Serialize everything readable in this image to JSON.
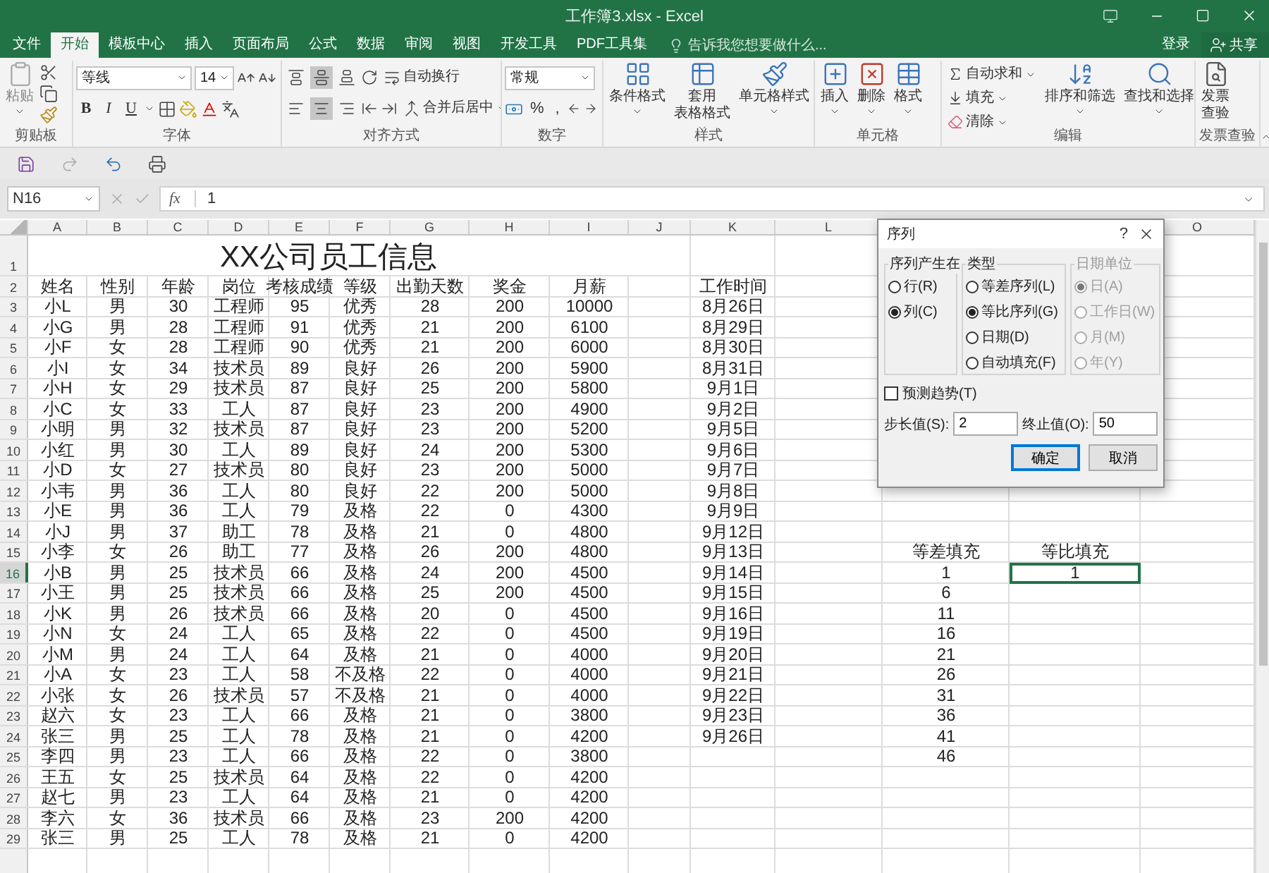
{
  "window": {
    "title": "工作簿3.xlsx - Excel"
  },
  "tabs": [
    {
      "label": "文件",
      "selected": false
    },
    {
      "label": "开始",
      "selected": true
    },
    {
      "label": "模板中心",
      "selected": false
    },
    {
      "label": "插入",
      "selected": false
    },
    {
      "label": "页面布局",
      "selected": false
    },
    {
      "label": "公式",
      "selected": false
    },
    {
      "label": "数据",
      "selected": false
    },
    {
      "label": "审阅",
      "selected": false
    },
    {
      "label": "视图",
      "selected": false
    },
    {
      "label": "开发工具",
      "selected": false
    },
    {
      "label": "PDF工具集",
      "selected": false
    }
  ],
  "tell_me": {
    "placeholder": "告诉我您想要做什么..."
  },
  "account": {
    "sign_in": "登录",
    "share": "共享"
  },
  "ribbon": {
    "groups": [
      {
        "kind": "clipboard",
        "label": "剪贴板",
        "buttons": [
          [
            "粘贴"
          ]
        ]
      },
      {
        "kind": "font",
        "label": "字体",
        "font": "等线",
        "size": "14",
        "format_buttons": [
          "B",
          "I",
          "U"
        ]
      },
      {
        "kind": "alignment",
        "label": "对齐方式",
        "buttons": [
          "自动换行",
          "合并后居中"
        ],
        "vertical": [
          {
            "selected": false
          },
          {
            "selected": true
          },
          {
            "selected": false
          }
        ],
        "horizontal": [
          {
            "selected": false
          },
          {
            "selected": true
          },
          {
            "selected": false
          }
        ]
      },
      {
        "kind": "number",
        "label": "数字",
        "format": "常规",
        "symbols": [
          "%",
          ","
        ]
      },
      {
        "kind": "styles",
        "label": "样式",
        "buttons": [
          [
            "条件格式"
          ],
          [
            "套用",
            "表格格式"
          ],
          [
            "单元格样式"
          ]
        ]
      },
      {
        "kind": "cells",
        "label": "单元格",
        "buttons": [
          [
            "插入"
          ],
          [
            "删除"
          ],
          [
            "格式"
          ]
        ]
      },
      {
        "kind": "editing",
        "label": "编辑",
        "small_buttons": [
          "自动求和",
          "填充",
          "清除"
        ],
        "buttons": [
          [
            "排序和筛选"
          ],
          [
            "查找和选择"
          ]
        ]
      },
      {
        "kind": "invoice",
        "label": "发票查验",
        "buttons": [
          [
            "发票",
            "查验"
          ]
        ]
      }
    ]
  },
  "formula_bar": {
    "name_box": "N16",
    "fx": "fx",
    "value": "1"
  },
  "sheet": {
    "column_headers": [
      "A",
      "B",
      "C",
      "D",
      "E",
      "F",
      "G",
      "H",
      "I",
      "J",
      "K",
      "L",
      "O"
    ],
    "rows": [
      {
        "number": "1",
        "selected": false,
        "title": "XX公司员工信息"
      },
      {
        "number": "2",
        "selected": false,
        "cells": [
          "姓名",
          "性别",
          "年龄",
          "岗位",
          "考核成绩",
          "等级",
          "出勤天数",
          "奖金",
          "月薪"
        ],
        "column_k": "工作时间"
      },
      {
        "number": "3",
        "selected": false,
        "cells": [
          "小L",
          "男",
          "30",
          "工程师",
          "95",
          "优秀",
          "28",
          "200",
          "10000"
        ],
        "column_k": "8月26日"
      },
      {
        "number": "4",
        "selected": false,
        "cells": [
          "小G",
          "男",
          "28",
          "工程师",
          "91",
          "优秀",
          "21",
          "200",
          "6100"
        ],
        "column_k": "8月29日"
      },
      {
        "number": "5",
        "selected": false,
        "cells": [
          "小F",
          "女",
          "28",
          "工程师",
          "90",
          "优秀",
          "21",
          "200",
          "6000"
        ],
        "column_k": "8月30日"
      },
      {
        "number": "6",
        "selected": false,
        "cells": [
          "小I",
          "女",
          "34",
          "技术员",
          "89",
          "良好",
          "26",
          "200",
          "5900"
        ],
        "column_k": "8月31日"
      },
      {
        "number": "7",
        "selected": false,
        "cells": [
          "小H",
          "女",
          "29",
          "技术员",
          "87",
          "良好",
          "25",
          "200",
          "5800"
        ],
        "column_k": "9月1日"
      },
      {
        "number": "8",
        "selected": false,
        "cells": [
          "小C",
          "女",
          "33",
          "工人",
          "87",
          "良好",
          "23",
          "200",
          "4900"
        ],
        "column_k": "9月2日"
      },
      {
        "number": "9",
        "selected": false,
        "cells": [
          "小明",
          "男",
          "32",
          "技术员",
          "87",
          "良好",
          "23",
          "200",
          "5200"
        ],
        "column_k": "9月5日"
      },
      {
        "number": "10",
        "selected": false,
        "cells": [
          "小红",
          "男",
          "30",
          "工人",
          "89",
          "良好",
          "24",
          "200",
          "5300"
        ],
        "column_k": "9月6日"
      },
      {
        "number": "11",
        "selected": false,
        "cells": [
          "小D",
          "女",
          "27",
          "技术员",
          "80",
          "良好",
          "23",
          "200",
          "5000"
        ],
        "column_k": "9月7日"
      },
      {
        "number": "12",
        "selected": false,
        "cells": [
          "小韦",
          "男",
          "36",
          "工人",
          "80",
          "良好",
          "22",
          "200",
          "5000"
        ],
        "column_k": "9月8日"
      },
      {
        "number": "13",
        "selected": false,
        "cells": [
          "小E",
          "男",
          "36",
          "工人",
          "79",
          "及格",
          "22",
          "0",
          "4300"
        ],
        "column_k": "9月9日"
      },
      {
        "number": "14",
        "selected": false,
        "cells": [
          "小J",
          "男",
          "37",
          "助工",
          "78",
          "及格",
          "21",
          "0",
          "4800"
        ],
        "column_k": "9月12日"
      },
      {
        "number": "15",
        "selected": false,
        "cells": [
          "小李",
          "女",
          "26",
          "助工",
          "77",
          "及格",
          "26",
          "200",
          "4800"
        ],
        "column_k": "9月13日",
        "column_m": "等差填充",
        "column_n": "等比填充"
      },
      {
        "number": "16",
        "selected": true,
        "cells": [
          "小B",
          "男",
          "25",
          "技术员",
          "66",
          "及格",
          "24",
          "200",
          "4500"
        ],
        "column_k": "9月14日",
        "column_m": "1",
        "column_n": "1"
      },
      {
        "number": "17",
        "selected": false,
        "cells": [
          "小王",
          "男",
          "25",
          "技术员",
          "66",
          "及格",
          "25",
          "200",
          "4500"
        ],
        "column_k": "9月15日",
        "column_m": "6"
      },
      {
        "number": "18",
        "selected": false,
        "cells": [
          "小K",
          "男",
          "26",
          "技术员",
          "66",
          "及格",
          "20",
          "0",
          "4500"
        ],
        "column_k": "9月16日",
        "column_m": "11"
      },
      {
        "number": "19",
        "selected": false,
        "cells": [
          "小N",
          "女",
          "24",
          "工人",
          "65",
          "及格",
          "22",
          "0",
          "4500"
        ],
        "column_k": "9月19日",
        "column_m": "16"
      },
      {
        "number": "20",
        "selected": false,
        "cells": [
          "小M",
          "男",
          "24",
          "工人",
          "64",
          "及格",
          "21",
          "0",
          "4000"
        ],
        "column_k": "9月20日",
        "column_m": "21"
      },
      {
        "number": "21",
        "selected": false,
        "cells": [
          "小A",
          "女",
          "23",
          "工人",
          "58",
          "不及格",
          "22",
          "0",
          "4000"
        ],
        "column_k": "9月21日",
        "column_m": "26"
      },
      {
        "number": "22",
        "selected": false,
        "cells": [
          "小张",
          "女",
          "26",
          "技术员",
          "57",
          "不及格",
          "21",
          "0",
          "4000"
        ],
        "column_k": "9月22日",
        "column_m": "31"
      },
      {
        "number": "23",
        "selected": false,
        "cells": [
          "赵六",
          "女",
          "23",
          "工人",
          "66",
          "及格",
          "21",
          "0",
          "3800"
        ],
        "column_k": "9月23日",
        "column_m": "36"
      },
      {
        "number": "24",
        "selected": false,
        "cells": [
          "张三",
          "男",
          "25",
          "工人",
          "78",
          "及格",
          "21",
          "0",
          "4200"
        ],
        "column_k": "9月26日",
        "column_m": "41"
      },
      {
        "number": "25",
        "selected": false,
        "cells": [
          "李四",
          "男",
          "23",
          "工人",
          "66",
          "及格",
          "22",
          "0",
          "3800"
        ],
        "column_m": "46"
      },
      {
        "number": "26",
        "selected": false,
        "cells": [
          "王五",
          "女",
          "25",
          "技术员",
          "64",
          "及格",
          "22",
          "0",
          "4200"
        ]
      },
      {
        "number": "27",
        "selected": false,
        "cells": [
          "赵七",
          "男",
          "23",
          "工人",
          "64",
          "及格",
          "21",
          "0",
          "4200"
        ]
      },
      {
        "number": "28",
        "selected": false,
        "cells": [
          "李六",
          "女",
          "36",
          "技术员",
          "66",
          "及格",
          "23",
          "200",
          "4200"
        ]
      },
      {
        "number": "29",
        "selected": false,
        "cells": [
          "张三",
          "男",
          "25",
          "工人",
          "78",
          "及格",
          "21",
          "0",
          "4200"
        ]
      }
    ]
  },
  "dialog": {
    "title": "序列",
    "help": "?",
    "groups": [
      {
        "label": "序列产生在",
        "disabled": false,
        "options": [
          {
            "label": "行(R)",
            "selected": false
          },
          {
            "label": "列(C)",
            "selected": true
          }
        ]
      },
      {
        "label": "类型",
        "disabled": false,
        "options": [
          {
            "label": "等差序列(L)",
            "selected": false
          },
          {
            "label": "等比序列(G)",
            "selected": true
          },
          {
            "label": "日期(D)",
            "selected": false
          },
          {
            "label": "自动填充(F)",
            "selected": false
          }
        ]
      },
      {
        "label": "日期单位",
        "disabled": true,
        "options": [
          {
            "label": "日(A)",
            "selected": true
          },
          {
            "label": "工作日(W)",
            "selected": false
          },
          {
            "label": "月(M)",
            "selected": false
          },
          {
            "label": "年(Y)",
            "selected": false
          }
        ]
      }
    ],
    "trend": {
      "label": "预测趋势(T)",
      "checked": false
    },
    "fields": [
      {
        "label": "步长值(S):",
        "value": "2"
      },
      {
        "label": "终止值(O):",
        "value": "50"
      }
    ],
    "buttons": [
      {
        "label": "确定",
        "default": true
      },
      {
        "label": "取消",
        "default": false
      }
    ]
  }
}
